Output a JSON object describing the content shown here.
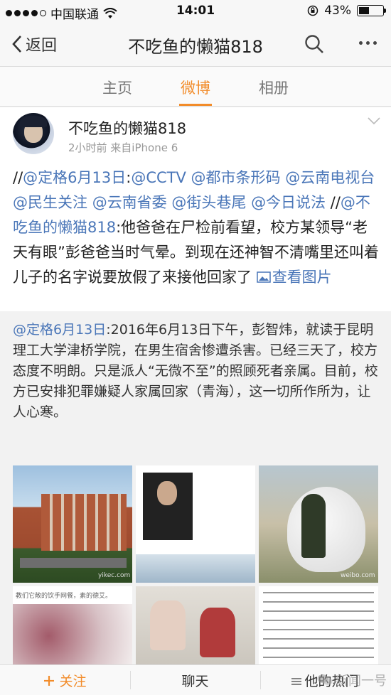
{
  "status_bar": {
    "carrier": "中国联通",
    "time": "14:01",
    "battery_percent": "43%",
    "battery_level": 0.43
  },
  "nav": {
    "back_label": "返回",
    "title": "不吃鱼的懒猫818"
  },
  "tabs": [
    {
      "label": "主页",
      "active": false
    },
    {
      "label": "微博",
      "active": true
    },
    {
      "label": "相册",
      "active": false
    }
  ],
  "post": {
    "username": "不吃鱼的懒猫818",
    "meta": "2小时前  来自iPhone 6",
    "segments": [
      {
        "text": "//",
        "link": false
      },
      {
        "text": "@定格6月13日",
        "link": true
      },
      {
        "text": ":",
        "link": false
      },
      {
        "text": "@CCTV",
        "link": true
      },
      {
        "text": " ",
        "link": false
      },
      {
        "text": "@都市条形码",
        "link": true
      },
      {
        "text": " ",
        "link": false
      },
      {
        "text": "@云南电视台",
        "link": true
      },
      {
        "text": " ",
        "link": false
      },
      {
        "text": "@民生关注",
        "link": true
      },
      {
        "text": " ",
        "link": false
      },
      {
        "text": "@云南省委",
        "link": true
      },
      {
        "text": " ",
        "link": false
      },
      {
        "text": "@街头巷尾",
        "link": true
      },
      {
        "text": " ",
        "link": false
      },
      {
        "text": "@今日说法",
        "link": true
      },
      {
        "text": " //",
        "link": false
      },
      {
        "text": "@不吃鱼的懒猫818",
        "link": true
      },
      {
        "text": ":他爸爸在尸检前看望，校方某领导“老天有眼”彭爸爸当时气晕。到现在还神智不清嘴里还叫着儿子的名字说要放假了来接他回家了 ",
        "link": false
      }
    ],
    "view_image_label": "查看图片"
  },
  "repost": {
    "author_link": "@定格6月13日",
    "text": ":2016年6月13日下午，彭智炜，就读于昆明理工大学津桥学院，在男生宿舍惨遭杀害。已经三天了，校方态度不明朗。只是派人“无微不至”的照顾死者亲属。目前，校方已安排犯罪嫌疑人家属回家（青海），这一切所作所为，让人心寒。",
    "image_captions": {
      "img1": "yikec.com",
      "img4": "教们它敞的饮手网餐，素的德艾。",
      "img3": "weibo.com"
    }
  },
  "bottom_bar": {
    "follow_label": "关注",
    "chat_label": "聊天",
    "hot_label": "他的热门",
    "watermark": "新闻一号"
  }
}
